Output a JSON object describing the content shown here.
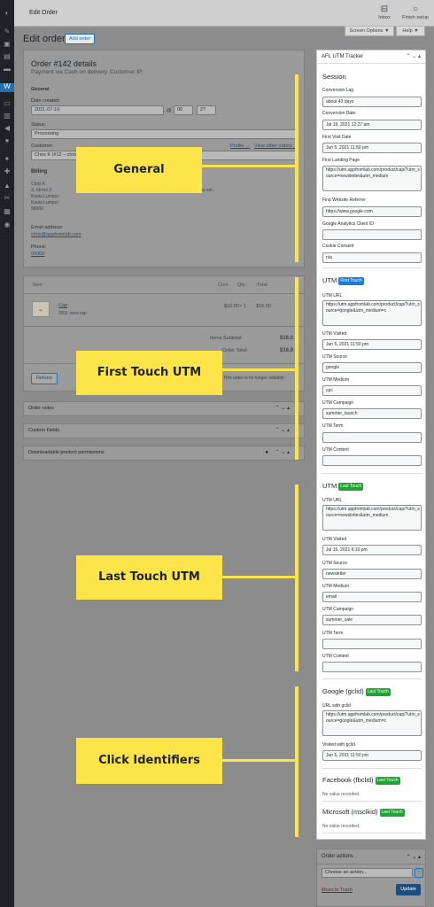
{
  "topbar": {
    "title": "Edit Order",
    "inbox": "Inbox",
    "finish_setup": "Finish setup"
  },
  "screen_options": "Screen Options ▼",
  "help": "Help ▼",
  "page": {
    "heading": "Edit order",
    "add_order": "Add order"
  },
  "order": {
    "title": "Order #142 details",
    "subtitle": "Payment via Cash on delivery. Customer IP:",
    "general": "General",
    "date_label": "Date created:",
    "date_value": "2021-07-19",
    "at": "@",
    "hour": "00",
    "minute": "27",
    "status_label": "Status:",
    "status_value": "Processing",
    "customer_label": "Customer:",
    "customer_value": "Chris K (#12 – chris...",
    "profile_link": "Profile →",
    "view_orders_link": "View other orders →",
    "billing_title": "Billing",
    "billing_lines": [
      "Chris K",
      "3, Street 3",
      "Kuala Lumpur",
      "Kuala Lumpur",
      "58000"
    ],
    "email_label": "Email address:",
    "email": "chris@appfromlab.com",
    "phone_label": "Phone:",
    "phone": "00000",
    "shipping_note": "No shipping address set."
  },
  "items": {
    "col_item": "Item",
    "col_cost": "Cost",
    "col_qty": "Qty",
    "col_total": "Total",
    "product_name": "Cap",
    "product_sku": "SKU: woo-cap",
    "cost": "$16.00",
    "qty": "× 1",
    "total": "$16.00",
    "subtotal_label": "Items Subtotal:",
    "subtotal_value": "$16.0",
    "order_total_label": "Order Total:",
    "order_total_value": "$16.0",
    "refund": "Refund",
    "not_editable": "This order is no longer editable."
  },
  "boxes": {
    "order_notes": "Order notes",
    "custom_fields": "Custom Fields",
    "downloadable": "Downloadable product permissions",
    "controls": "⌃ ⌄ ▴"
  },
  "overlay_labels": {
    "general": "General",
    "first_touch": "First Touch UTM",
    "last_touch": "Last Touch UTM",
    "click_ids": "Click Identifiers"
  },
  "utm": {
    "box_title": "AFL UTM Tracker",
    "box_controls": "⌃ ⌄ ▴",
    "session_title": "Session",
    "session": [
      {
        "label": "Conversion Lag",
        "value": "about 43 days"
      },
      {
        "label": "Conversion Date",
        "value": "Jul 19, 2021 12:27 am"
      },
      {
        "label": "First Visit Date",
        "value": "Jun 5, 2021 11:50 pm"
      },
      {
        "label": "First Landing Page",
        "value": "https://utm.appfromlab.com/product/cap/?utm_source=newsletter&utm_medium"
      },
      {
        "label": "First Website Referrer",
        "value": "https://www.google.com"
      },
      {
        "label": "Google Analytics Client ID",
        "value": ""
      },
      {
        "label": "Cookie Consent",
        "value": "n/a"
      }
    ],
    "utm_word": "UTM",
    "first_badge": "First Touch",
    "first": [
      {
        "label": "UTM URL",
        "value": "https://utm.appfromlab.com/product/cap/?utm_source=google&utm_medium=c"
      },
      {
        "label": "UTM Visited",
        "value": "Jun 5, 2021 11:50 pm"
      },
      {
        "label": "UTM Source",
        "value": "google"
      },
      {
        "label": "UTM Medium",
        "value": "cpc"
      },
      {
        "label": "UTM Campaign",
        "value": "summer_launch"
      },
      {
        "label": "UTM Term",
        "value": ""
      },
      {
        "label": "UTM Content",
        "value": ""
      }
    ],
    "last_badge": "Last Touch",
    "last": [
      {
        "label": "UTM URL",
        "value": "https://utm.appfromlab.com/product/cap/?utm_source=newsletter&utm_medium"
      },
      {
        "label": "UTM Visited",
        "value": "Jul 15, 2021 6:10 pm"
      },
      {
        "label": "UTM Source",
        "value": "newsletter"
      },
      {
        "label": "UTM Medium",
        "value": "email"
      },
      {
        "label": "UTM Campaign",
        "value": "summer_sale"
      },
      {
        "label": "UTM Term",
        "value": ""
      },
      {
        "label": "UTM Content",
        "value": ""
      }
    ],
    "gclid_title": "Google (gclid)",
    "gclid_badge": "Last Touch",
    "gclid_url_label": "URL with gclid",
    "gclid_url": "https://utm.appfromlab.com/product/cap/?utm_source=google&utm_medium=c",
    "gclid_visited_label": "Visited with gclid",
    "gclid_visited": "Jun 5, 2021 11:50 pm",
    "fbclid_title": "Facebook (fbclid)",
    "fbclid_badge": "Last Touch",
    "fbclid_none": "No value recorded.",
    "msclkid_title": "Microsoft (msclkid)",
    "msclkid_badge": "Last Touch",
    "msclkid_none": "No value recorded."
  },
  "order_actions": {
    "title": "Order actions",
    "controls": "⌃ ⌄ ▴",
    "select": "Choose an action...",
    "go": "›",
    "trash": "Move to Trash",
    "update": "Update"
  }
}
